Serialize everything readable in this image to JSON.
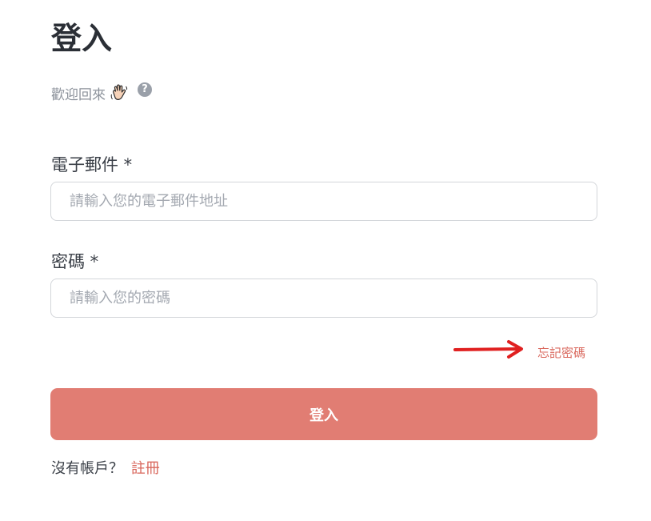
{
  "header": {
    "title": "登入",
    "subtitle": "歡迎回來",
    "wave_icon": "waving-hand-icon",
    "help_icon": "question-circle-icon",
    "help_glyph": "?"
  },
  "form": {
    "email": {
      "label": "電子郵件 *",
      "placeholder": "請輸入您的電子郵件地址",
      "value": ""
    },
    "password": {
      "label": "密碼 *",
      "placeholder": "請輸入您的密碼",
      "value": ""
    },
    "forgot_password": "忘記密碼",
    "submit_label": "登入"
  },
  "footer": {
    "prompt": "沒有帳戶？",
    "signup_label": "註冊"
  },
  "colors": {
    "accent": "#e17d73",
    "link": "#d9675c",
    "annotation_arrow": "#e02020",
    "muted_text": "#8c929b",
    "border": "#d3d6da"
  }
}
